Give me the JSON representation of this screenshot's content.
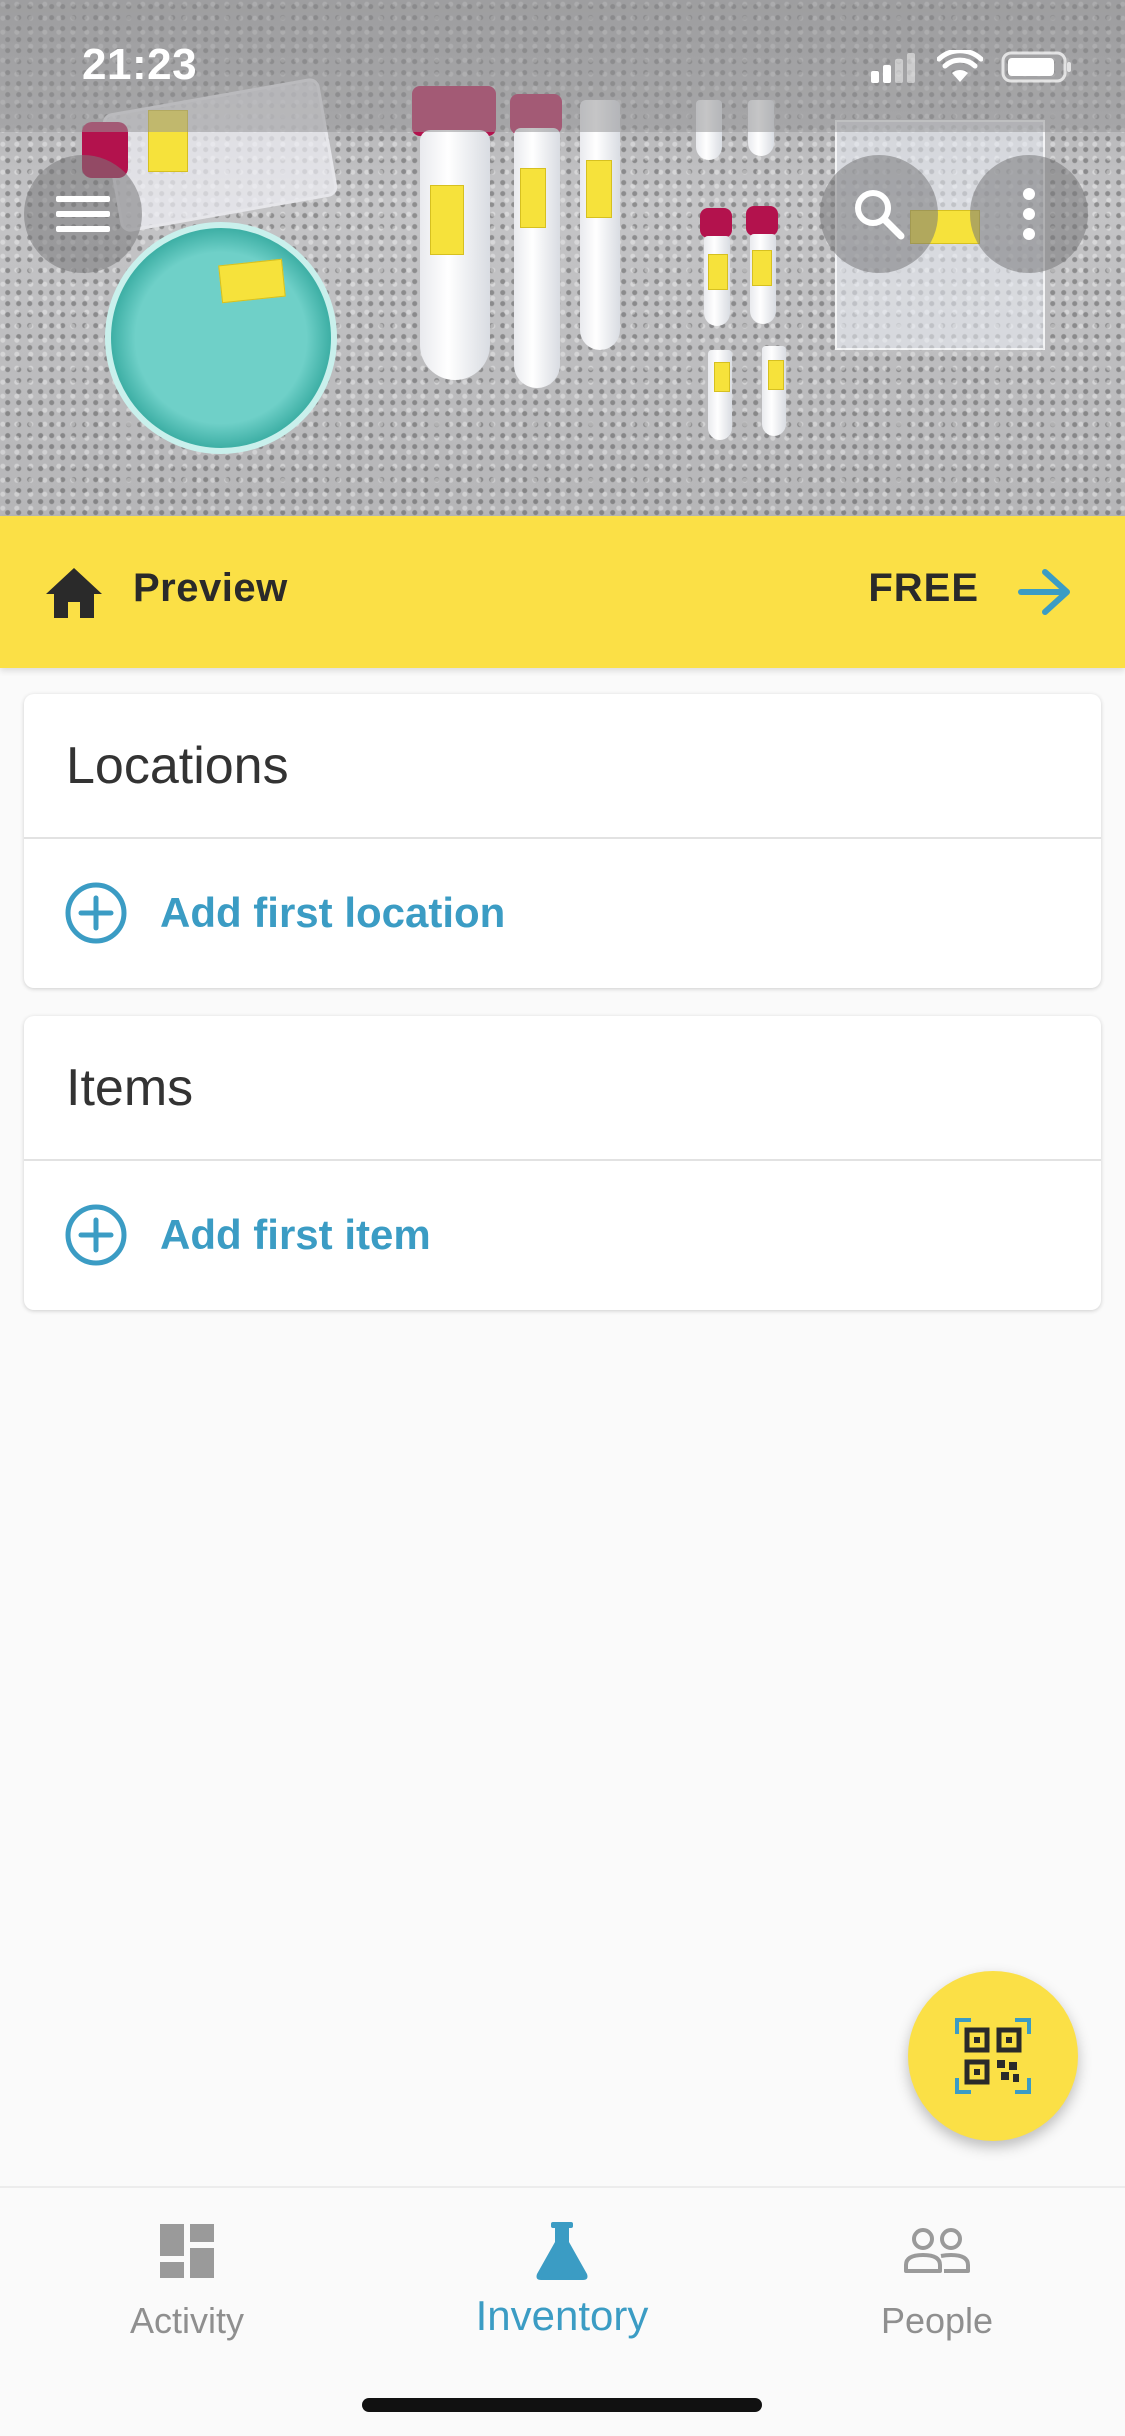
{
  "status_bar": {
    "time": "21:23"
  },
  "hero": {
    "menu_icon": "hamburger-menu-icon",
    "search_icon": "search-icon",
    "more_icon": "more-vertical-icon"
  },
  "preview_bar": {
    "icon": "home-icon",
    "label": "Preview",
    "plan": "FREE",
    "arrow_icon": "arrow-right-icon"
  },
  "sections": {
    "locations": {
      "title": "Locations",
      "action": "Add first location"
    },
    "items": {
      "title": "Items",
      "action": "Add first item"
    }
  },
  "fab": {
    "icon": "qr-code-scan-icon"
  },
  "bottom_nav": {
    "activity": {
      "label": "Activity",
      "icon": "dashboard-icon"
    },
    "inventory": {
      "label": "Inventory",
      "icon": "flask-icon"
    },
    "people": {
      "label": "People",
      "icon": "people-icon"
    },
    "active": "inventory"
  },
  "colors": {
    "accent_yellow": "#fbe046",
    "accent_blue": "#3b9cc4",
    "text_dark": "#2a2a2a",
    "nav_inactive": "#8f8f8f"
  }
}
